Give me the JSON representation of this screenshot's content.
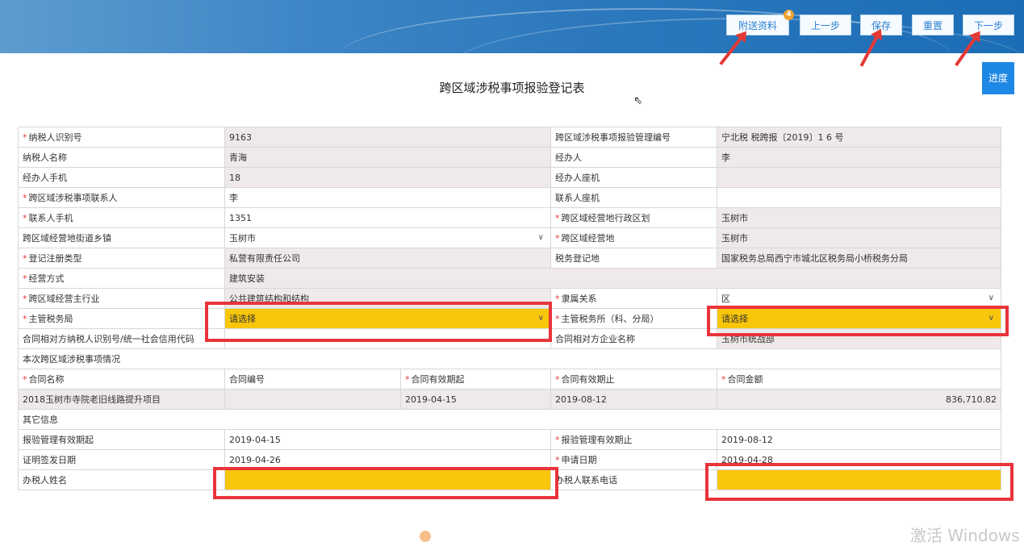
{
  "toolbar": {
    "attach_label": "附送资料",
    "attach_badge": "4",
    "prev_label": "上一步",
    "save_label": "保存",
    "reset_label": "重置",
    "next_label": "下一步",
    "progress_label": "进度"
  },
  "form": {
    "title": "跨区域涉税事项报验登记表",
    "rows": {
      "taxpayer_id_label": "纳税人识别号",
      "taxpayer_id": "9163",
      "mgmt_no_label": "跨区域涉税事项报验管理编号",
      "mgmt_no": "宁北税 税跨报〔2019〕1    6 号",
      "taxpayer_name_label": "纳税人名称",
      "taxpayer_name": "青海",
      "handler_label": "经办人",
      "handler": "李",
      "handler_mobile_label": "经办人手机",
      "handler_mobile": "18",
      "handler_phone_label": "经办人座机",
      "contact_label": "跨区域涉税事项联系人",
      "contact": "李",
      "contact_phone_label": "联系人座机",
      "contact_mobile_label": "联系人手机",
      "contact_mobile": "1351",
      "region_label": "跨区域经营地行政区划",
      "region": "玉树市",
      "street_label": "跨区域经营地街道乡镇",
      "street": "玉树市",
      "place_label": "跨区域经营地",
      "place": "玉树市",
      "reg_type_label": "登记注册类型",
      "reg_type": "私营有限责任公司",
      "tax_reg_place_label": "税务登记地",
      "tax_reg_place": "国家税务总局西宁市城北区税务局小桥税务分局",
      "biz_mode_label": "经营方式",
      "biz_mode": "建筑安装",
      "industry_label": "跨区域经营主行业",
      "industry": "公共建筑结构和结构",
      "affiliation_label": "隶属关系",
      "affiliation": "区",
      "tax_bureau_label": "主管税务局",
      "tax_bureau": "请选择",
      "tax_office_label": "主管税务所（科、分局）",
      "tax_office": "请选择",
      "counter_id_label": "合同相对方纳税人识别号/统一社会信用代码",
      "counter_name_label": "合同相对方企业名称",
      "counter_name": "玉树市统战部",
      "section_matters": "本次跨区域涉税事项情况",
      "contract_name_label": "合同名称",
      "contract_no_label": "合同编号",
      "contract_start_label": "合同有效期起",
      "contract_end_label": "合同有效期止",
      "contract_amount_label": "合同金额",
      "contract_name": "2018玉树市寺院老旧线路提升项目",
      "contract_start": "2019-04-15",
      "contract_end": "2019-08-12",
      "contract_amount": "836,710.82",
      "section_other": "其它信息",
      "valid_from_label": "报验管理有效期起",
      "valid_from": "2019-04-15",
      "valid_to_label": "报验管理有效期止",
      "valid_to": "2019-08-12",
      "issue_date_label": "证明签发日期",
      "issue_date": "2019-04-26",
      "apply_date_label": "申请日期",
      "apply_date": "2019-04-28",
      "agent_name_label": "办税人姓名",
      "agent_phone_label": "办税人联系电话"
    }
  },
  "watermark": "激活 Windows"
}
